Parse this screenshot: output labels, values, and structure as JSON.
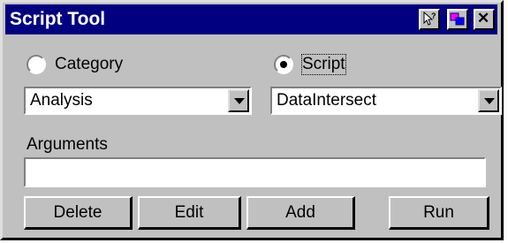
{
  "window": {
    "title": "Script Tool"
  },
  "title_buttons": [
    {
      "icon": "help-pointer-icon"
    },
    {
      "icon": "restore-icon"
    },
    {
      "icon": "close-icon",
      "label": "✕"
    }
  ],
  "radios": {
    "category": {
      "label": "Category",
      "selected": false
    },
    "script": {
      "label": "Script",
      "selected": true
    }
  },
  "combos": {
    "category_value": "Analysis",
    "script_value": "DataIntersect"
  },
  "arguments": {
    "label": "Arguments",
    "value": ""
  },
  "buttons": {
    "delete": "Delete",
    "edit": "Edit",
    "add": "Add",
    "run": "Run"
  },
  "colors": {
    "titlebar": "#000080",
    "face": "#c0c0c0",
    "field": "#ffffff"
  }
}
